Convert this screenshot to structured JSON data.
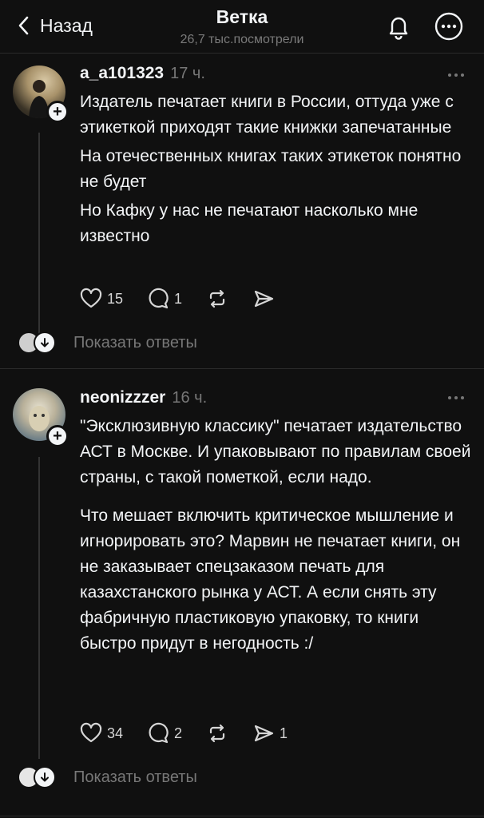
{
  "header": {
    "back_label": "Назад",
    "title": "Ветка",
    "views": "26,7 тыс.посмотрели"
  },
  "posts": [
    {
      "username": "a_a101323",
      "time": "17 ч.",
      "paragraphs": [
        "Издатель печатает книги в России, оттуда уже с этикеткой приходят такие книжки запечатанные",
        "На отечественных книгах таких этикеток понятно не будет",
        "Но Кафку у нас не печатают насколько мне известно"
      ],
      "likes": "15",
      "comments": "1",
      "shares": "",
      "show_replies": "Показать ответы"
    },
    {
      "username": "neonizzzer",
      "time": "16 ч.",
      "paragraphs": [
        "\"Эксклюзивную классику\" печатает издательство АСТ в Москве. И упаковывают по правилам своей страны, с такой пометкой, если надо.",
        "Что мешает включить критическое мышление и игнорировать это? Марвин не печатает книги, он не заказывает спецзаказом печать для казахстанского рынка у АСТ. А если снять эту фабричную пластиковую упаковку, то книги быстро придут в негодность :/"
      ],
      "likes": "34",
      "comments": "2",
      "shares": "1",
      "show_replies": "Показать ответы"
    }
  ],
  "icons": {
    "back": "chevron-left-icon",
    "bell": "bell-icon",
    "more": "more-circle-icon",
    "like": "heart-icon",
    "comment": "comment-icon",
    "repost": "repost-icon",
    "share": "send-icon"
  },
  "colors": {
    "background": "#101010",
    "text": "#f3f5f7",
    "muted": "#777777"
  }
}
